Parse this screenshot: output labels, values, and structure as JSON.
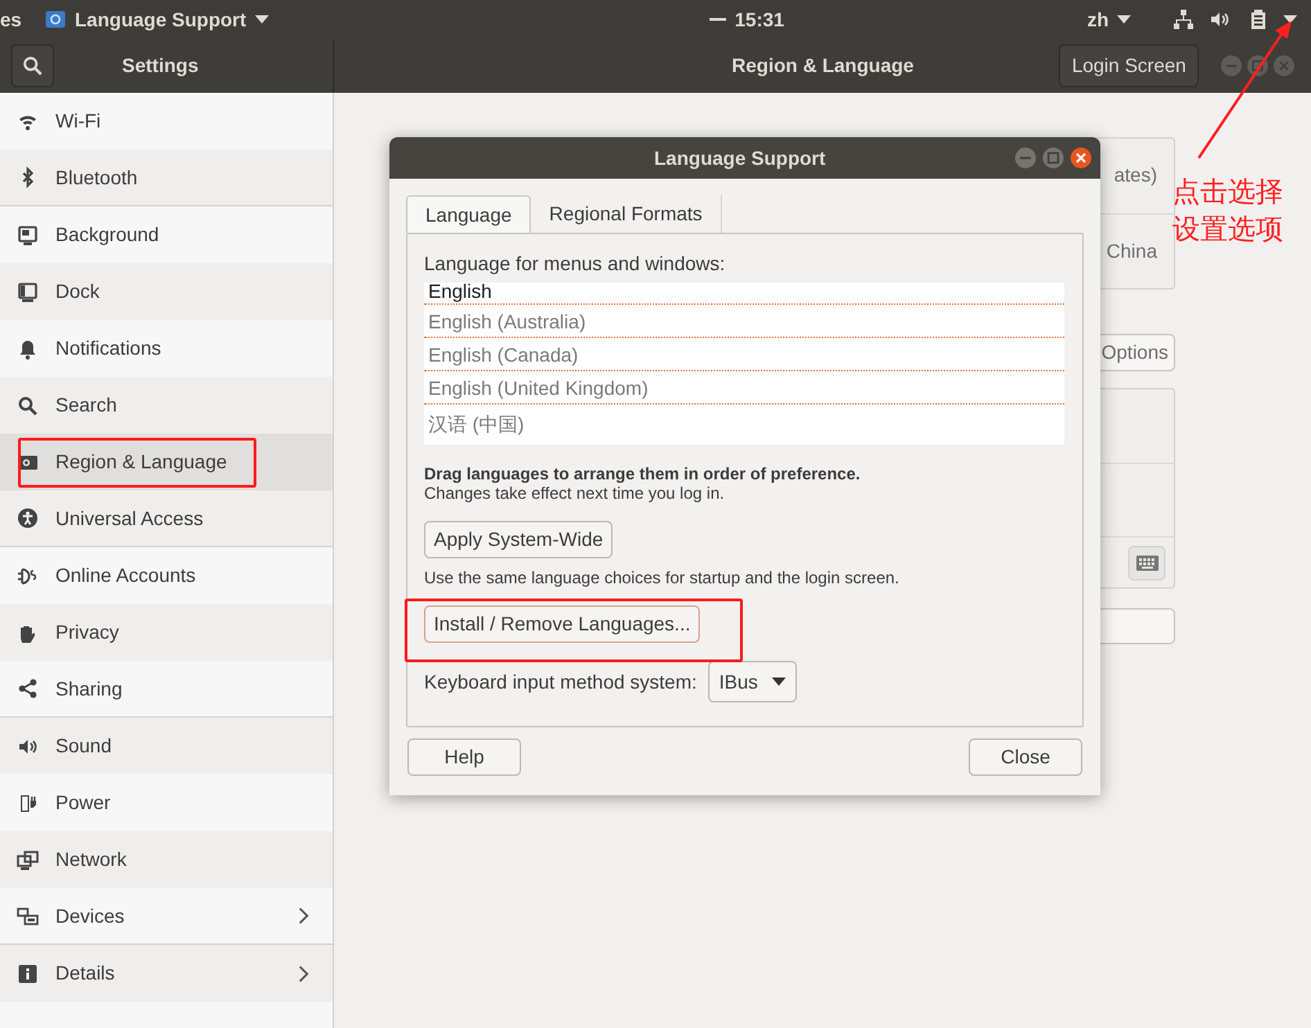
{
  "top_bar": {
    "activities": "es",
    "app_menu": "Language Support",
    "clock": "15:31",
    "input_source": "zh"
  },
  "header": {
    "sidebar_title": "Settings",
    "title": "Region & Language",
    "login_screen_button": "Login Screen"
  },
  "sidebar": {
    "items": [
      {
        "label": "Wi-Fi",
        "selected": false,
        "chevron": false,
        "divider_after": false
      },
      {
        "label": "Bluetooth",
        "selected": false,
        "chevron": false,
        "divider_after": true
      },
      {
        "label": "Background",
        "selected": false,
        "chevron": false,
        "divider_after": false
      },
      {
        "label": "Dock",
        "selected": false,
        "chevron": false,
        "divider_after": false
      },
      {
        "label": "Notifications",
        "selected": false,
        "chevron": false,
        "divider_after": false
      },
      {
        "label": "Search",
        "selected": false,
        "chevron": false,
        "divider_after": false
      },
      {
        "label": "Region & Language",
        "selected": true,
        "chevron": false,
        "divider_after": false
      },
      {
        "label": "Universal Access",
        "selected": false,
        "chevron": false,
        "divider_after": true
      },
      {
        "label": "Online Accounts",
        "selected": false,
        "chevron": false,
        "divider_after": false
      },
      {
        "label": "Privacy",
        "selected": false,
        "chevron": false,
        "divider_after": false
      },
      {
        "label": "Sharing",
        "selected": false,
        "chevron": false,
        "divider_after": true
      },
      {
        "label": "Sound",
        "selected": false,
        "chevron": false,
        "divider_after": false
      },
      {
        "label": "Power",
        "selected": false,
        "chevron": false,
        "divider_after": false
      },
      {
        "label": "Network",
        "selected": false,
        "chevron": false,
        "divider_after": false
      },
      {
        "label": "Devices",
        "selected": false,
        "chevron": true,
        "divider_after": true
      },
      {
        "label": "Details",
        "selected": false,
        "chevron": true,
        "divider_after": false
      }
    ]
  },
  "background_panel": {
    "rows": [
      "ates)",
      "China"
    ],
    "options_button": "Options"
  },
  "dialog": {
    "title": "Language Support",
    "tabs": [
      {
        "label": "Language",
        "selected": true
      },
      {
        "label": "Regional Formats",
        "selected": false
      }
    ],
    "list_label": "Language for menus and windows:",
    "languages": [
      {
        "label": "English",
        "active": true
      },
      {
        "label": "English (Australia)",
        "active": false
      },
      {
        "label": "English (Canada)",
        "active": false
      },
      {
        "label": "English (United Kingdom)",
        "active": false
      },
      {
        "label": "汉语 (中国)",
        "active": false
      }
    ],
    "drag_hint": "Drag languages to arrange them in order of preference.",
    "changes_note": "Changes take effect next time you log in.",
    "apply_button": "Apply System-Wide",
    "apply_note": "Use the same language choices for startup and the login screen.",
    "install_button": "Install / Remove Languages...",
    "input_method_label": "Keyboard input method system:",
    "input_method_value": "IBus",
    "help_button": "Help",
    "close_button": "Close"
  },
  "annotation": {
    "note": "点击选择设置选项"
  }
}
